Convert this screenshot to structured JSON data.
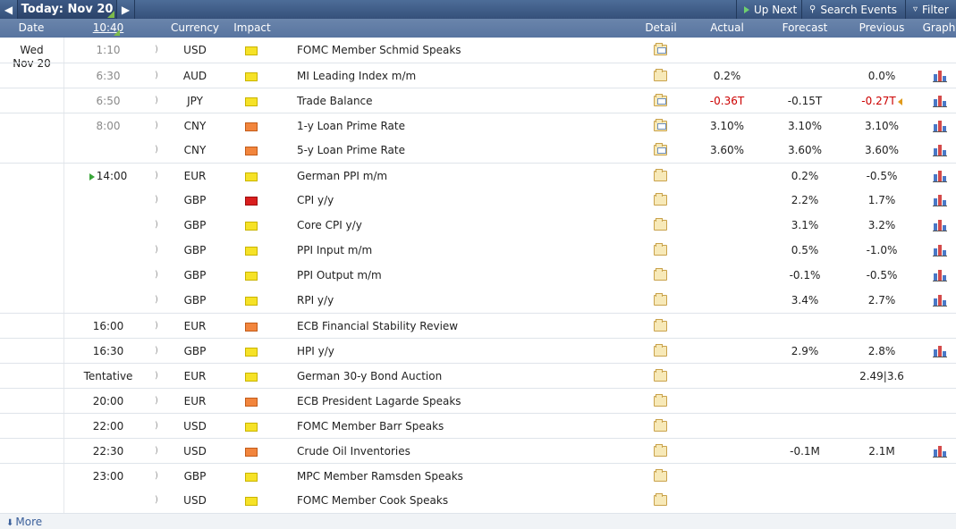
{
  "toolbar": {
    "prev_icon": "triangle-left-icon",
    "today_label": "Today: Nov 20",
    "next_icon": "triangle-right-icon",
    "up_next_label": "Up Next",
    "search_label": "Search Events",
    "filter_label": "Filter"
  },
  "columns": {
    "date": "Date",
    "time": "10:40",
    "currency": "Currency",
    "impact": "Impact",
    "detail": "Detail",
    "actual": "Actual",
    "forecast": "Forecast",
    "previous": "Previous",
    "graph": "Graph"
  },
  "date": {
    "day": "Wed",
    "date": "Nov 20"
  },
  "events": [
    {
      "time": "1:10",
      "currency": "USD",
      "impact": "low",
      "event": "FOMC Member Schmid Speaks",
      "actual": "",
      "forecast": "",
      "previous": "",
      "graph": false
    },
    {
      "time": "6:30",
      "currency": "AUD",
      "impact": "low",
      "event": "MI Leading Index m/m",
      "actual": "0.2%",
      "forecast": "",
      "previous": "0.0%",
      "graph": true
    },
    {
      "time": "6:50",
      "currency": "JPY",
      "impact": "low",
      "event": "Trade Balance",
      "actual": "-0.36T",
      "forecast": "-0.15T",
      "previous": "-0.27T",
      "graph": true
    },
    {
      "time": "8:00",
      "currency": "CNY",
      "impact": "medium",
      "event": "1-y Loan Prime Rate",
      "actual": "3.10%",
      "forecast": "3.10%",
      "previous": "3.10%",
      "graph": true
    },
    {
      "time": "",
      "currency": "CNY",
      "impact": "medium",
      "event": "5-y Loan Prime Rate",
      "actual": "3.60%",
      "forecast": "3.60%",
      "previous": "3.60%",
      "graph": true
    },
    {
      "time": "14:00",
      "currency": "EUR",
      "impact": "low",
      "event": "German PPI m/m",
      "actual": "",
      "forecast": "0.2%",
      "previous": "-0.5%",
      "graph": true
    },
    {
      "time": "",
      "currency": "GBP",
      "impact": "high",
      "event": "CPI y/y",
      "actual": "",
      "forecast": "2.2%",
      "previous": "1.7%",
      "graph": true
    },
    {
      "time": "",
      "currency": "GBP",
      "impact": "low",
      "event": "Core CPI y/y",
      "actual": "",
      "forecast": "3.1%",
      "previous": "3.2%",
      "graph": true
    },
    {
      "time": "",
      "currency": "GBP",
      "impact": "low",
      "event": "PPI Input m/m",
      "actual": "",
      "forecast": "0.5%",
      "previous": "-1.0%",
      "graph": true
    },
    {
      "time": "",
      "currency": "GBP",
      "impact": "low",
      "event": "PPI Output m/m",
      "actual": "",
      "forecast": "-0.1%",
      "previous": "-0.5%",
      "graph": true
    },
    {
      "time": "",
      "currency": "GBP",
      "impact": "low",
      "event": "RPI y/y",
      "actual": "",
      "forecast": "3.4%",
      "previous": "2.7%",
      "graph": true
    },
    {
      "time": "16:00",
      "currency": "EUR",
      "impact": "medium",
      "event": "ECB Financial Stability Review",
      "actual": "",
      "forecast": "",
      "previous": "",
      "graph": false
    },
    {
      "time": "16:30",
      "currency": "GBP",
      "impact": "low",
      "event": "HPI y/y",
      "actual": "",
      "forecast": "2.9%",
      "previous": "2.8%",
      "graph": true
    },
    {
      "time": "Tentative",
      "currency": "EUR",
      "impact": "low",
      "event": "German 30-y Bond Auction",
      "actual": "",
      "forecast": "",
      "previous": "2.49|3.6",
      "graph": false
    },
    {
      "time": "20:00",
      "currency": "EUR",
      "impact": "medium",
      "event": "ECB President Lagarde Speaks",
      "actual": "",
      "forecast": "",
      "previous": "",
      "graph": false
    },
    {
      "time": "22:00",
      "currency": "USD",
      "impact": "low",
      "event": "FOMC Member Barr Speaks",
      "actual": "",
      "forecast": "",
      "previous": "",
      "graph": false
    },
    {
      "time": "22:30",
      "currency": "USD",
      "impact": "medium",
      "event": "Crude Oil Inventories",
      "actual": "",
      "forecast": "-0.1M",
      "previous": "2.1M",
      "graph": true
    },
    {
      "time": "23:00",
      "currency": "GBP",
      "impact": "low",
      "event": "MPC Member Ramsden Speaks",
      "actual": "",
      "forecast": "",
      "previous": "",
      "graph": false
    },
    {
      "time": "",
      "currency": "USD",
      "impact": "low",
      "event": "FOMC Member Cook Speaks",
      "actual": "",
      "forecast": "",
      "previous": "",
      "graph": false
    }
  ],
  "footer": {
    "more_label": "More"
  },
  "colors": {
    "toolbar": "#35507a",
    "header": "#5874a0",
    "negative": "#cc0000",
    "low_impact": "#f6e227",
    "medium_impact": "#f2853d",
    "high_impact": "#d91e1e"
  }
}
